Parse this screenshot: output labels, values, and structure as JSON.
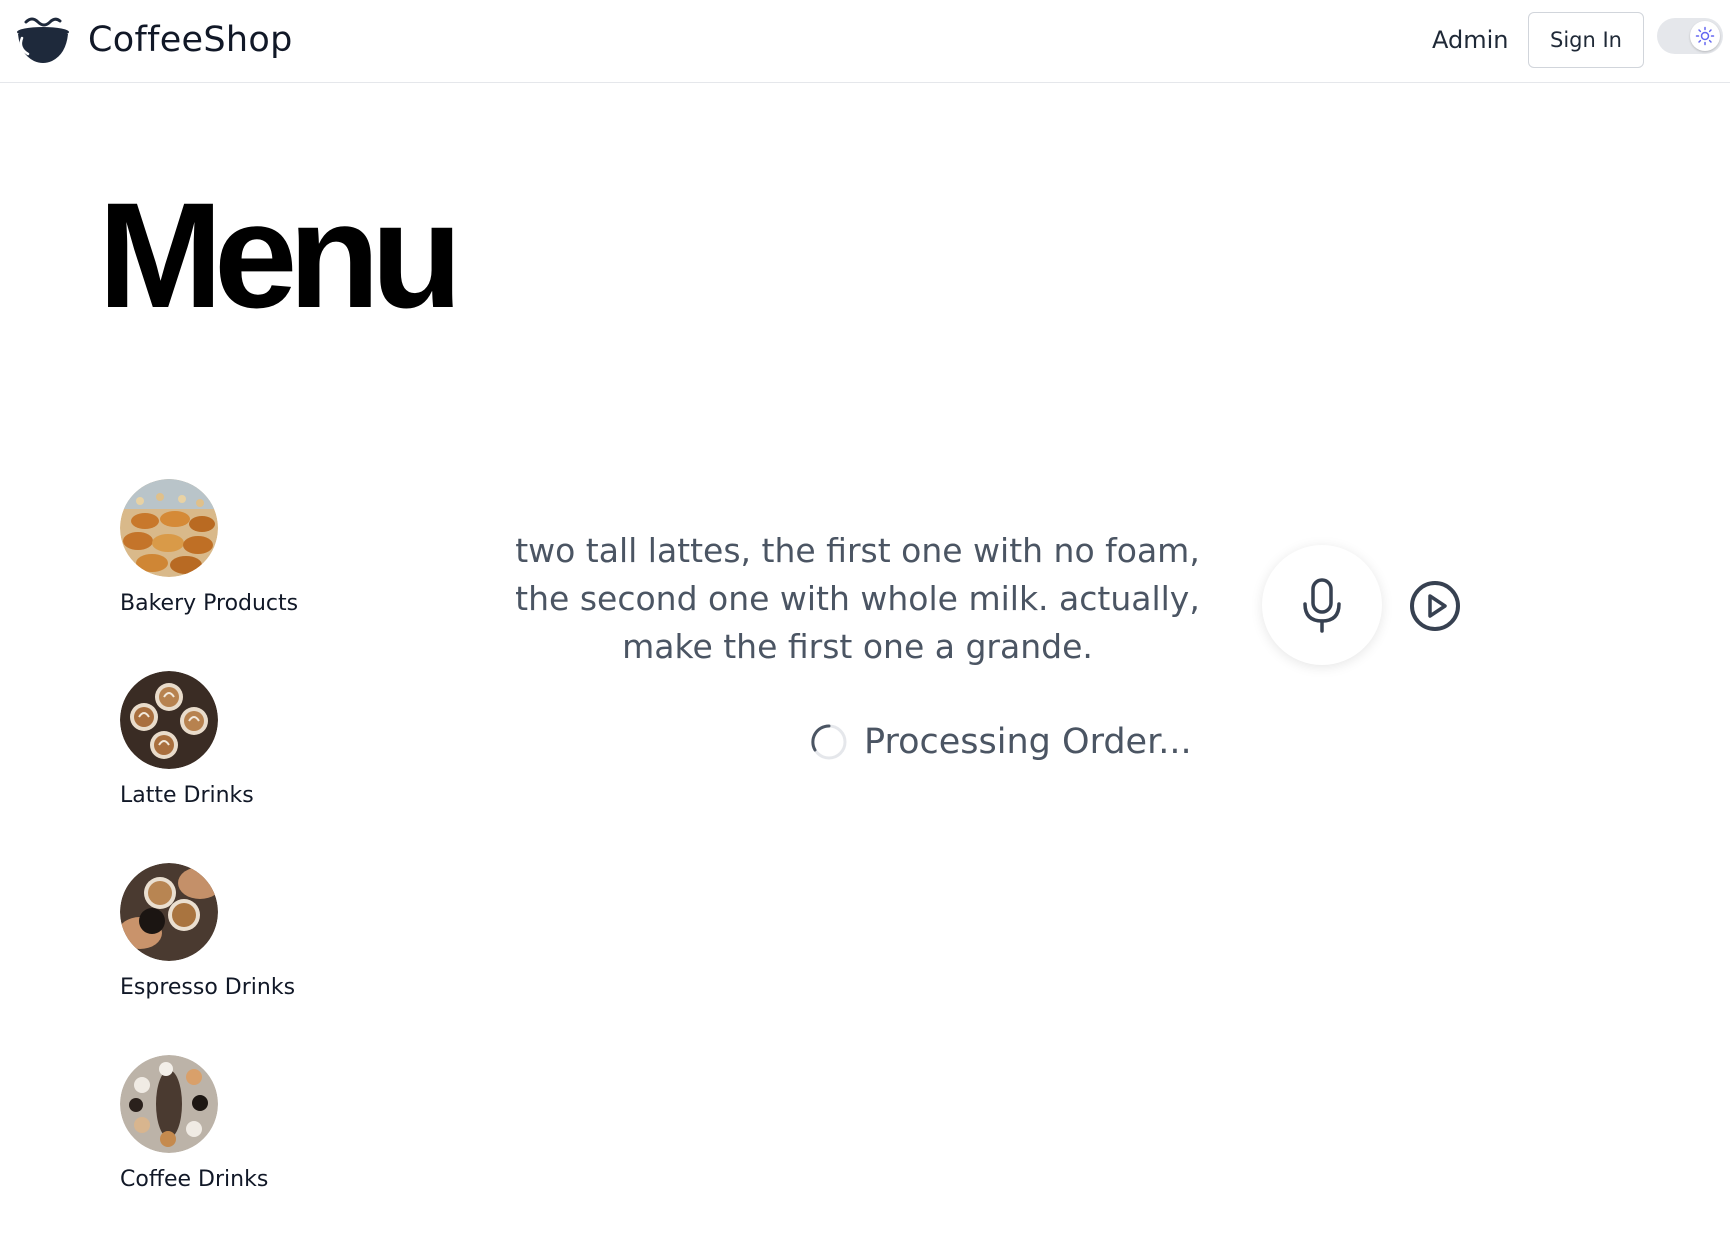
{
  "header": {
    "brand_name": "CoffeeShop",
    "logo_icon": "coffee-cup-icon",
    "nav": {
      "admin_label": "Admin",
      "signin_label": "Sign In"
    },
    "theme_toggle": {
      "icon": "sun-icon",
      "state": "light"
    }
  },
  "main": {
    "title": "Menu",
    "categories": [
      {
        "label": "Bakery Products",
        "image": "bakery-image"
      },
      {
        "label": "Latte Drinks",
        "image": "latte-image"
      },
      {
        "label": "Espresso Drinks",
        "image": "espresso-image"
      },
      {
        "label": "Coffee Drinks",
        "image": "coffee-image"
      }
    ],
    "voice_order": {
      "transcript_lines": [
        "two tall lattes, the first one with no foam,",
        "the second one with whole milk. actually,",
        "make the first one a grande."
      ],
      "mic_icon": "microphone-icon",
      "play_icon": "play-circle-icon",
      "status_text": "Processing Order..."
    }
  },
  "colors": {
    "brand": "#1e293b",
    "text_muted": "#4b5563",
    "border": "#e5e7eb",
    "accent_sun": "#6366f1"
  }
}
